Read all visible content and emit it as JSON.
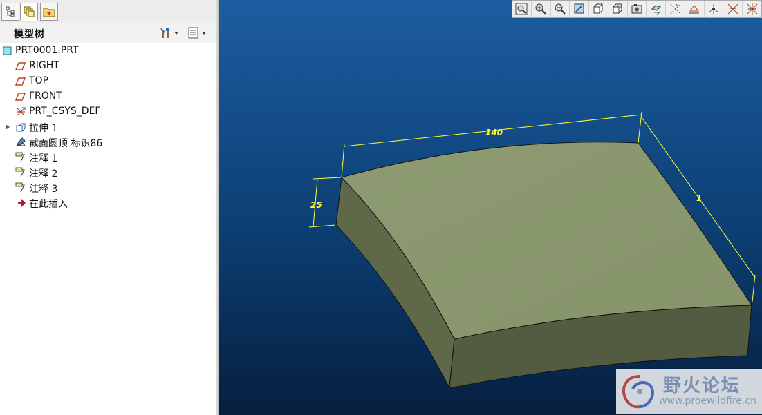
{
  "tabs": [
    {
      "icon": "model-tree-icon"
    },
    {
      "icon": "layers-icon"
    },
    {
      "icon": "favorites-icon"
    }
  ],
  "panel": {
    "title": "模型树",
    "settings_icon": "tools-icon",
    "show_icon": "show-columns-icon"
  },
  "tree": {
    "root": "PRT0001.PRT",
    "items": [
      {
        "label": "RIGHT",
        "icon": "datum-plane-icon"
      },
      {
        "label": "TOP",
        "icon": "datum-plane-icon"
      },
      {
        "label": "FRONT",
        "icon": "datum-plane-icon"
      },
      {
        "label": "PRT_CSYS_DEF",
        "icon": "coordinate-system-icon"
      },
      {
        "label": "拉伸 1",
        "icon": "extrude-icon"
      },
      {
        "label": "截面圆顶 标识86",
        "icon": "section-dome-icon"
      },
      {
        "label": "注释 1",
        "icon": "annotation-icon"
      },
      {
        "label": "注释 2",
        "icon": "annotation-icon"
      },
      {
        "label": "注释 3",
        "icon": "annotation-icon"
      },
      {
        "label": "在此插入",
        "icon": "insert-here-arrow-icon"
      }
    ]
  },
  "viewport": {
    "background_top": "#1d5da0",
    "background_bottom": "#061f3f",
    "model_top_color": "#8c9970",
    "dimension_color": "#ffff33",
    "dimensions": {
      "width": "140",
      "height": "25",
      "depth": "1"
    }
  },
  "toolbar_icons": [
    "zoom-fit-icon",
    "zoom-in-icon",
    "zoom-out-icon",
    "repaint-icon",
    "orient-icon",
    "saved-views-icon",
    "display-style-icon",
    "plane-display-icon",
    "axis-display-icon",
    "point-display-icon",
    "csys-display-icon",
    "annotation-display-icon",
    "spin-center-icon"
  ],
  "watermark": {
    "title": "野火论坛",
    "url": "www.proewildfire.cn"
  }
}
